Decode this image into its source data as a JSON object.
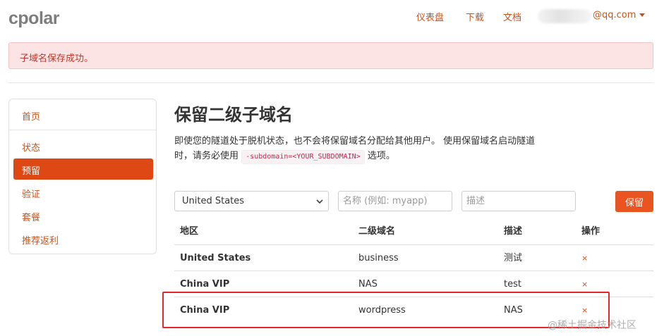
{
  "brand": {
    "logo": "cpolar"
  },
  "topnav": {
    "dashboard": "仪表盘",
    "download": "下载",
    "docs": "文档",
    "user_email": "@qq.com"
  },
  "alert": {
    "message": "子域名保存成功。",
    "color": "#c0392b"
  },
  "sidebar": {
    "items": [
      {
        "label": "首页",
        "active": false
      },
      {
        "label": "状态",
        "active": false
      },
      {
        "label": "预留",
        "active": true
      },
      {
        "label": "验证",
        "active": false
      },
      {
        "label": "套餐",
        "active": false
      },
      {
        "label": "推荐返利",
        "active": false
      }
    ]
  },
  "main": {
    "title": "保留二级子域名",
    "desc_line1": "即使您的隧道处于脱机状态，也不会将保留域名分配给其他用户。 使用保留域名启动隧道",
    "desc_line2_before": "时，请务必使用",
    "desc_code": "-subdomain=<YOUR_SUBDOMAIN>",
    "desc_line2_after": "选项。"
  },
  "form": {
    "region_selected": "United States",
    "name_placeholder": "名称 (例如: myapp)",
    "desc_placeholder": "描述",
    "save_label": "保留",
    "accent_color": "#e95420"
  },
  "table": {
    "headers": {
      "region": "地区",
      "subdomain": "二级域名",
      "desc": "描述",
      "action": "操作"
    },
    "rows": [
      {
        "region": "United States",
        "subdomain": "business",
        "desc": "测试",
        "action": "×"
      },
      {
        "region": "China VIP",
        "subdomain": "NAS",
        "desc": "test",
        "action": "×"
      },
      {
        "region": "China VIP",
        "subdomain": "wordpress",
        "desc": "NAS",
        "action": "×"
      }
    ]
  },
  "watermark": "@稀土掘金技术社区"
}
